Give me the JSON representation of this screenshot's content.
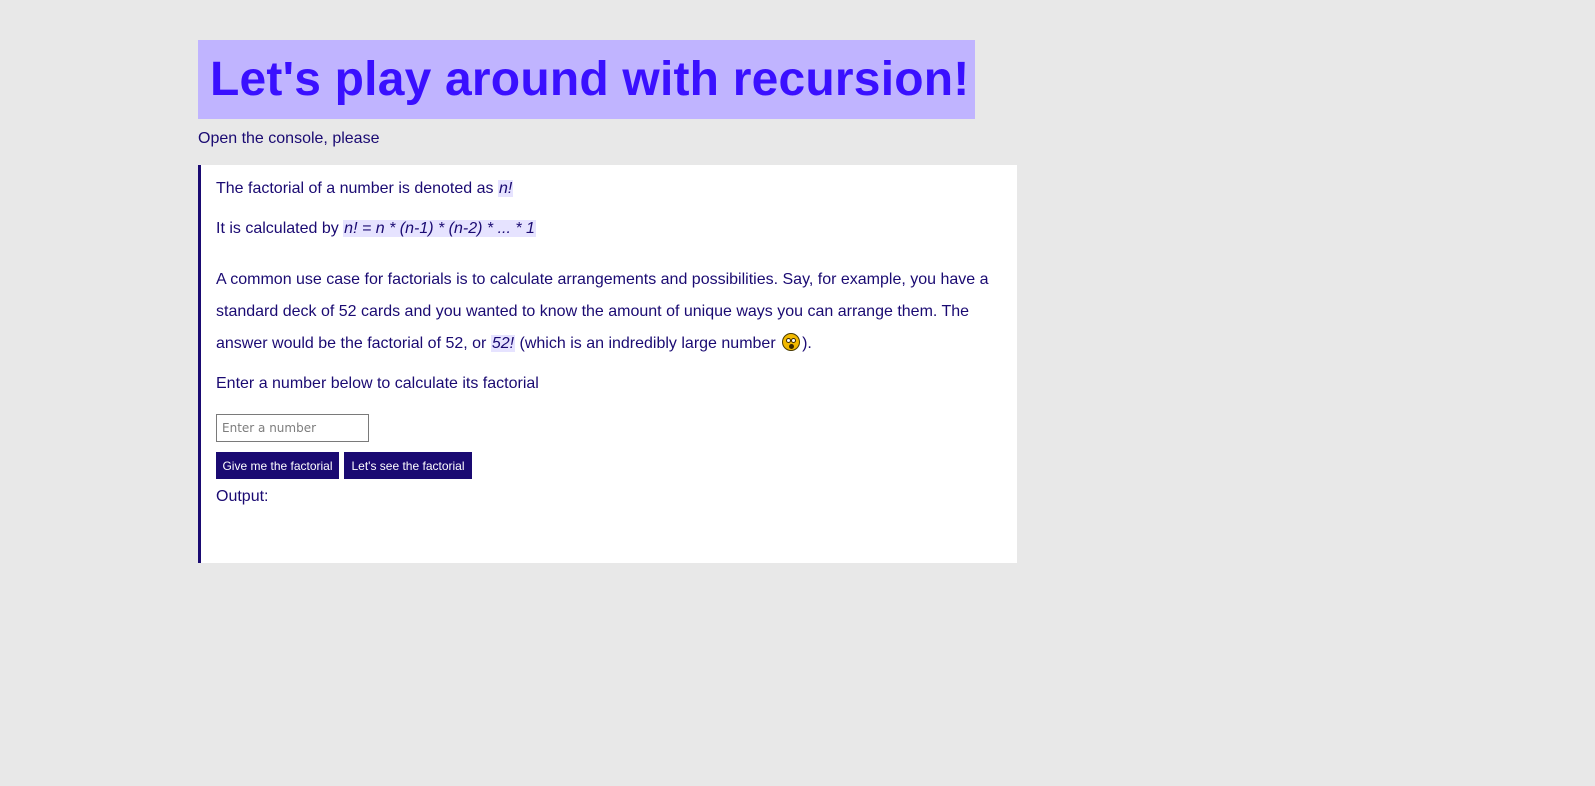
{
  "header": {
    "title": "Let's play around with recursion!",
    "subtitle": "Open the console, please"
  },
  "panel": {
    "line1_text": "The factorial of a number is denoted as ",
    "line1_code": "n!",
    "line2_text": "It is calculated by ",
    "line2_code": "n! = n * (n-1) * (n-2) * ... * 1",
    "para_before": "A common use case for factorials is to calculate arrangements and possibilities. Say, for example, you have a standard deck of 52 cards and you wanted to know the amount of unique ways you can arrange them. The answer would be the factorial of 52, or ",
    "para_code": "52!",
    "para_mid": " (which is an indredibly large number ",
    "para_end": ").",
    "prompt": "Enter a number below to calculate its factorial",
    "input_placeholder": "Enter a number",
    "input_value": "",
    "button_give": "Give me the factorial",
    "button_see": "Let's see the factorial",
    "output_label": "Output:"
  },
  "icons": {
    "emoji": "astonished-face-icon"
  },
  "colors": {
    "background": "#e8e8e8",
    "title_bg": "#c0b4ff",
    "title_text": "#3a10ff",
    "text": "#1a0a72",
    "button_bg": "#1a0a72",
    "button_text": "#ffffff",
    "code_bg": "#e6e3ff"
  }
}
